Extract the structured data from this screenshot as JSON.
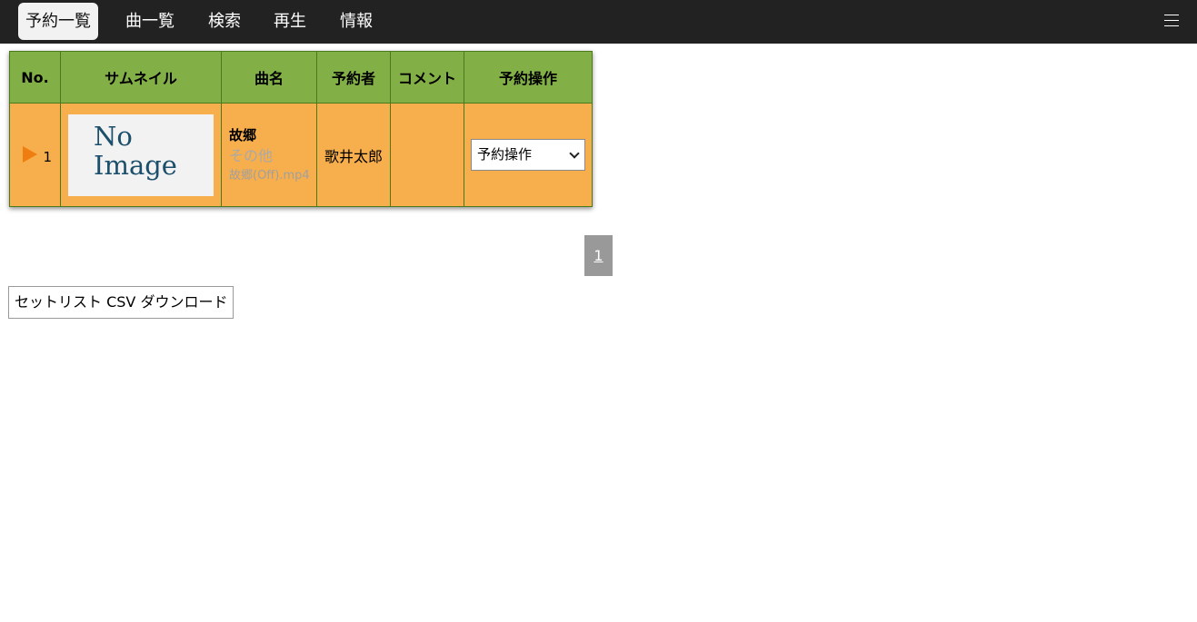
{
  "nav": {
    "items": [
      {
        "label": "予約一覧",
        "active": true
      },
      {
        "label": "曲一覧",
        "active": false
      },
      {
        "label": "検索",
        "active": false
      },
      {
        "label": "再生",
        "active": false
      },
      {
        "label": "情報",
        "active": false
      }
    ],
    "menu_icon": "hamburger-menu-icon"
  },
  "table": {
    "headers": [
      "No.",
      "サムネイル",
      "曲名",
      "予約者",
      "コメント",
      "予約操作"
    ],
    "rows": [
      {
        "playing": true,
        "no": "1",
        "thumbnail_text": [
          "No",
          "Image"
        ],
        "title": "故郷",
        "genre": "その他",
        "file": "故郷(Off).mp4",
        "user": "歌井太郎",
        "comment": "",
        "operation": "予約操作"
      }
    ]
  },
  "pager": {
    "pages": [
      "1"
    ],
    "current": "1"
  },
  "csv_button": "セットリスト CSV ダウンロード",
  "colors": {
    "navbar": "#222222",
    "header": "#82b046",
    "row": "#f7ae4c",
    "play": "#ef7d0f",
    "pager": "#999999"
  }
}
